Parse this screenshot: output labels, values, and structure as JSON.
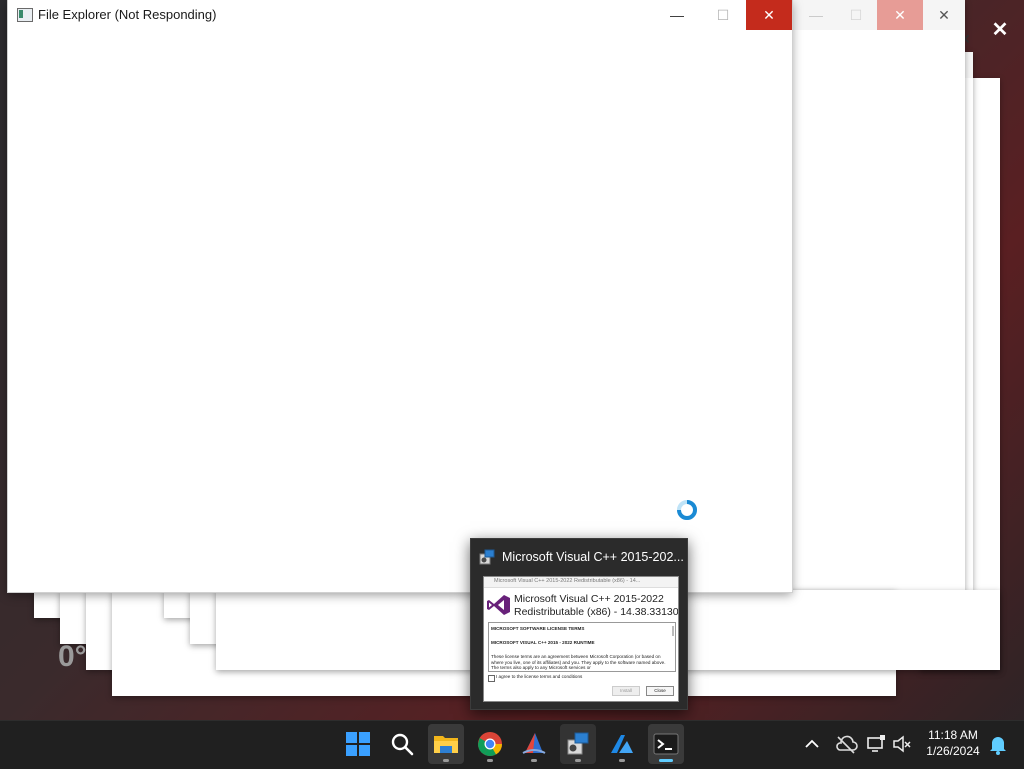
{
  "main_window": {
    "title": "File Explorer (Not Responding)",
    "minimize_glyph": "—",
    "maximize_glyph": "☐",
    "close_glyph": "✕"
  },
  "ghost_windows": {
    "close_glyph": "✕",
    "minimize_glyph": "—",
    "maximize_glyph": "☐"
  },
  "overlay": {
    "close_glyph": "✕",
    "partial_text": "0°"
  },
  "taskbar_preview": {
    "title": "Microsoft Visual C++ 2015-202...",
    "thumb": {
      "window_title": "Microsoft Visual C++ 2015-2022 Redistributable (x86) - 14...",
      "product_line1": "Microsoft Visual C++ 2015-2022",
      "product_line2": "Redistributable (x86) - 14.38.33130",
      "license_heading": "MICROSOFT SOFTWARE LICENSE TERMS",
      "license_subheading": "MICROSOFT VISUAL C++ 2015 - 2022 RUNTIME",
      "license_body": "These license terms are an agreement between Microsoft Corporation (or based on where you live, one of its affiliates) and you. They apply to the software named above. The terms also apply to any Microsoft services or",
      "agree_label": "I agree to the license terms and conditions",
      "install_label": "Install",
      "close_label": "Close"
    }
  },
  "taskbar": {
    "apps": [
      {
        "name": "start",
        "icon": "windows-logo-icon"
      },
      {
        "name": "search",
        "icon": "search-icon"
      },
      {
        "name": "file-explorer",
        "icon": "folder-icon"
      },
      {
        "name": "chrome",
        "icon": "chrome-icon"
      },
      {
        "name": "app-sail",
        "icon": "sail-app-icon"
      },
      {
        "name": "installer",
        "icon": "installer-icon"
      },
      {
        "name": "azure",
        "icon": "azure-icon"
      },
      {
        "name": "terminal",
        "icon": "terminal-icon"
      }
    ],
    "tray": {
      "chevron_glyph": "^",
      "time": "11:18 AM",
      "date": "1/26/2024"
    }
  },
  "colors": {
    "close_red": "#c42b1c",
    "accent_blue": "#60cdff",
    "vs_purple": "#68217a"
  }
}
